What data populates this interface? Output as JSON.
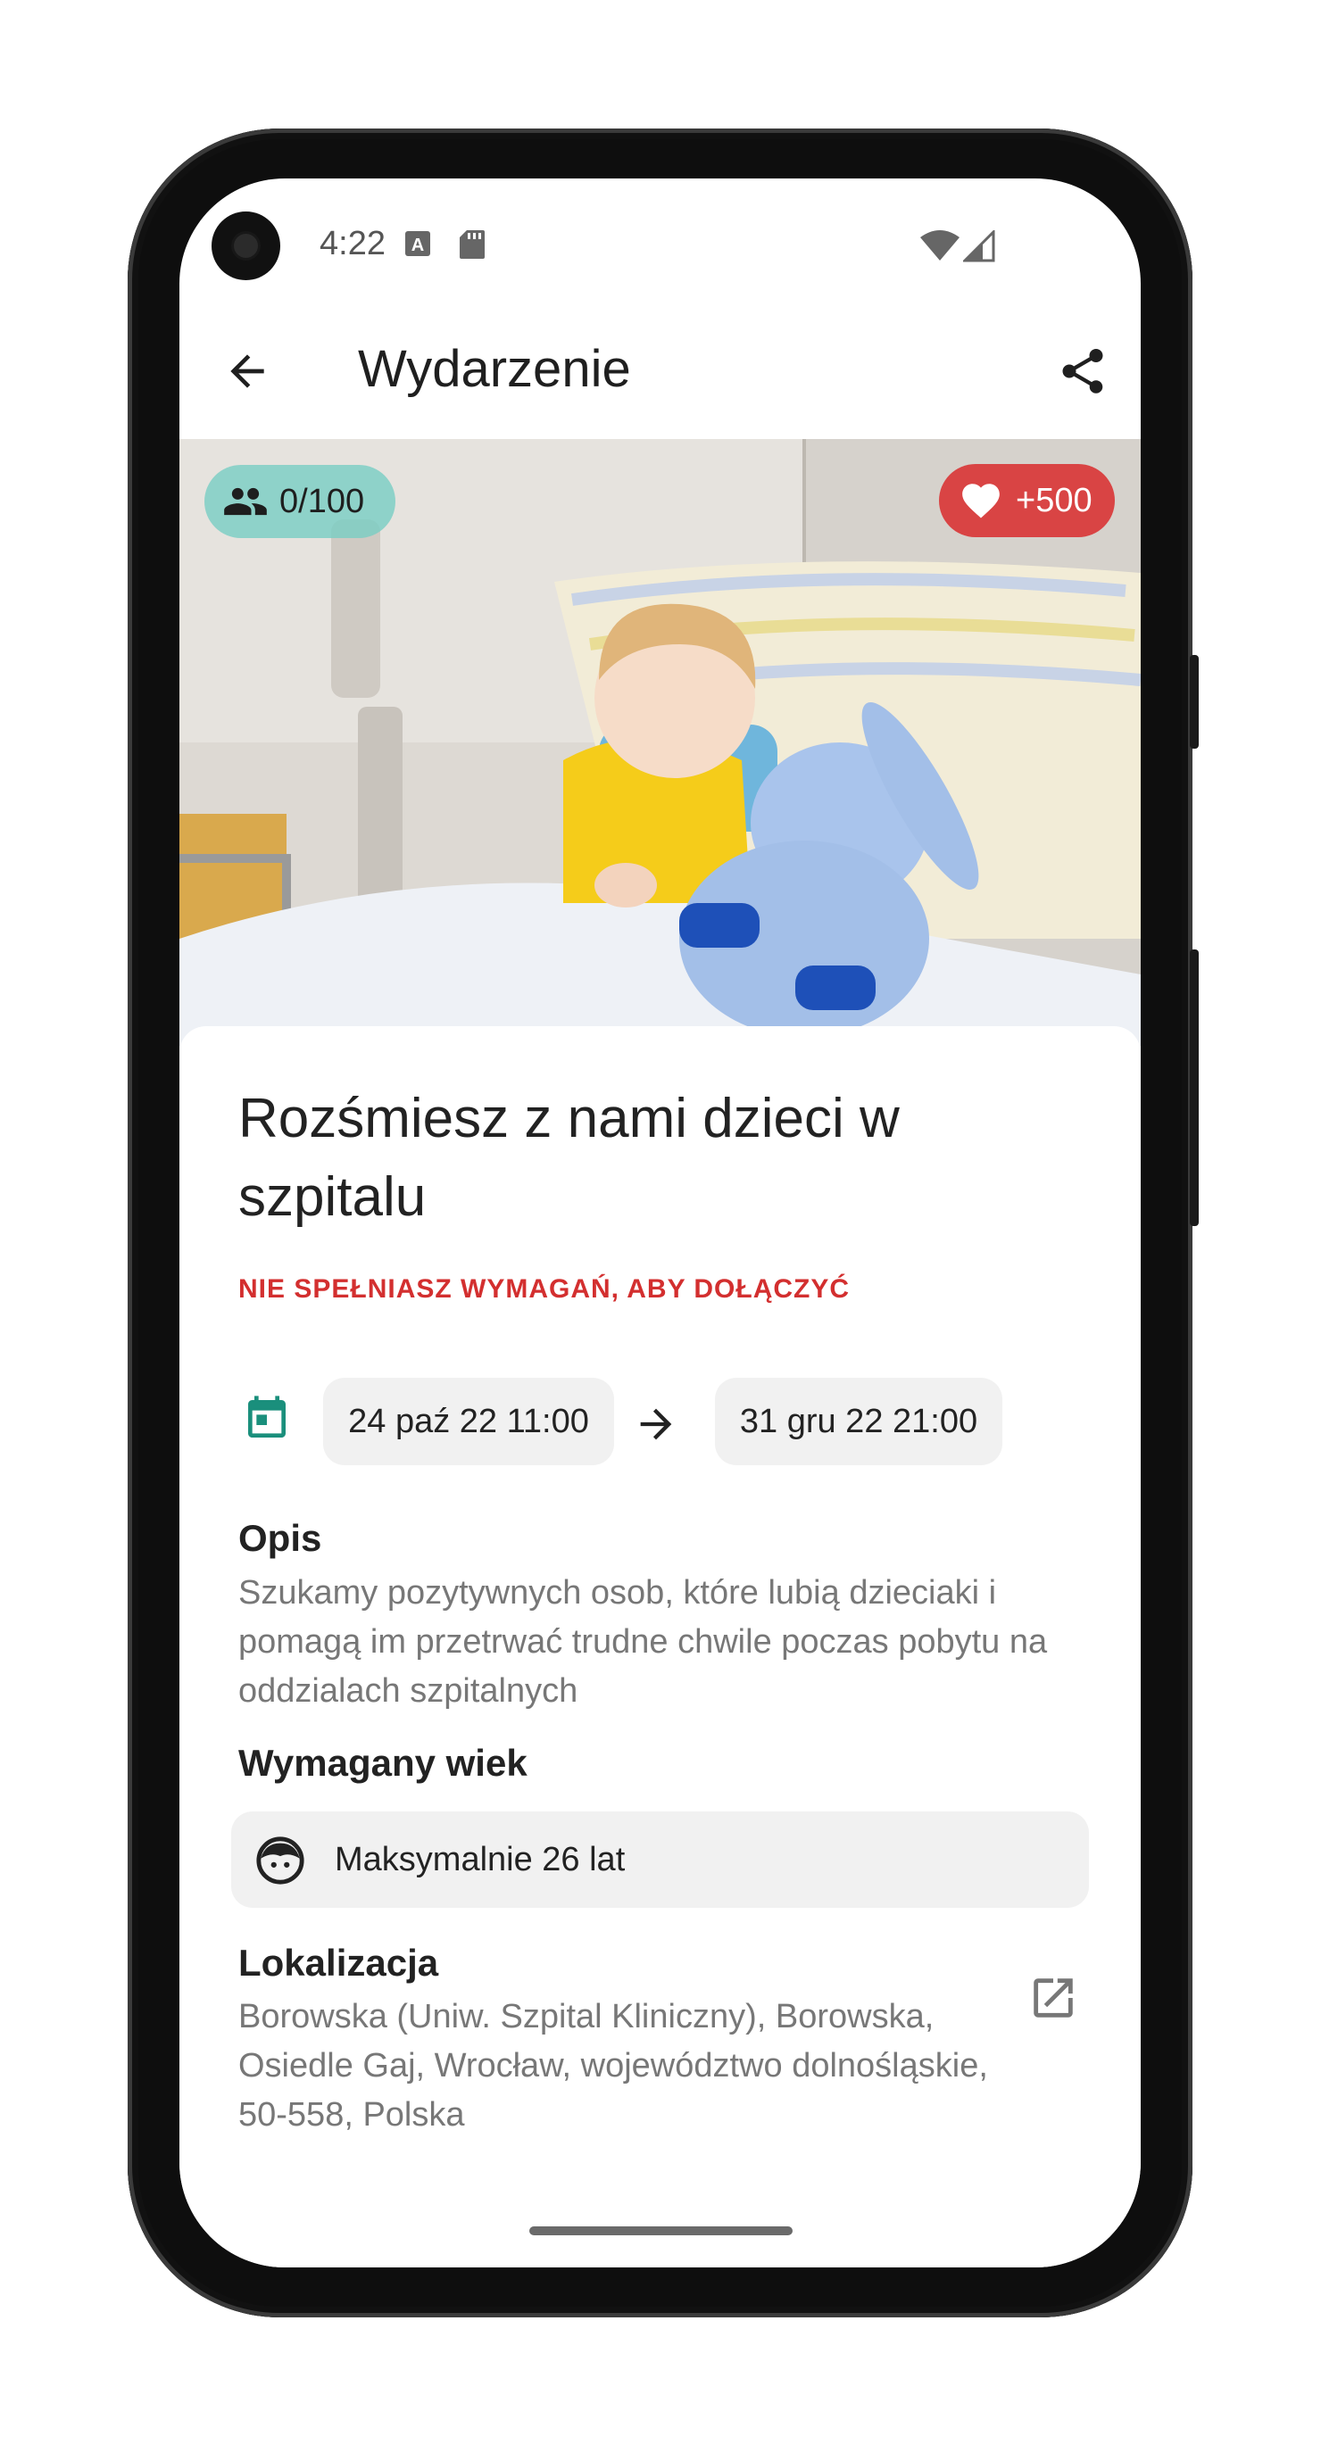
{
  "status_bar": {
    "time": "4:22"
  },
  "app_bar": {
    "title": "Wydarzenie"
  },
  "hero": {
    "participants": "0/100",
    "points": "+500"
  },
  "event": {
    "title": "Rozśmiesz z nami dzieci w szpitalu",
    "warning": "NIE SPEŁNIASZ WYMAGAŃ, ABY DOŁĄCZYĆ",
    "start": "24 paź 22 11:00",
    "end": "31 gru 22 21:00",
    "description_label": "Opis",
    "description": "Szukamy pozytywnych osob, które lubią dzieciaki i pomagą im przetrwać trudne chwile poczas pobytu na oddzialach szpitalnych",
    "age_label": "Wymagany wiek",
    "age_value": "Maksymalnie 26 lat",
    "location_label": "Lokalizacja",
    "location": "Borowska (Uniw. Szpital Kliniczny), Borowska, Osiedle Gaj, Wrocław, województwo dolnośląskie, 50-558, Polska"
  },
  "colors": {
    "accent": "#1a8f7c",
    "warning": "#d32f2f",
    "heart_chip": "#d94444",
    "people_chip": "#78cdc3"
  },
  "icons": [
    "back-arrow-icon",
    "share-icon",
    "people-icon",
    "heart-icon",
    "calendar-icon",
    "arrow-right-icon",
    "child-face-icon",
    "open-external-icon"
  ]
}
